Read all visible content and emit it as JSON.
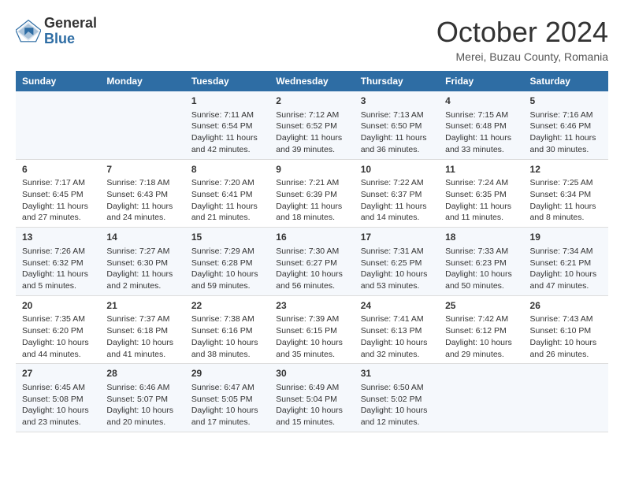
{
  "header": {
    "logo_general": "General",
    "logo_blue": "Blue",
    "month_title": "October 2024",
    "location": "Merei, Buzau County, Romania"
  },
  "weekdays": [
    "Sunday",
    "Monday",
    "Tuesday",
    "Wednesday",
    "Thursday",
    "Friday",
    "Saturday"
  ],
  "weeks": [
    [
      {
        "day": "",
        "sunrise": "",
        "sunset": "",
        "daylight": ""
      },
      {
        "day": "",
        "sunrise": "",
        "sunset": "",
        "daylight": ""
      },
      {
        "day": "1",
        "sunrise": "Sunrise: 7:11 AM",
        "sunset": "Sunset: 6:54 PM",
        "daylight": "Daylight: 11 hours and 42 minutes."
      },
      {
        "day": "2",
        "sunrise": "Sunrise: 7:12 AM",
        "sunset": "Sunset: 6:52 PM",
        "daylight": "Daylight: 11 hours and 39 minutes."
      },
      {
        "day": "3",
        "sunrise": "Sunrise: 7:13 AM",
        "sunset": "Sunset: 6:50 PM",
        "daylight": "Daylight: 11 hours and 36 minutes."
      },
      {
        "day": "4",
        "sunrise": "Sunrise: 7:15 AM",
        "sunset": "Sunset: 6:48 PM",
        "daylight": "Daylight: 11 hours and 33 minutes."
      },
      {
        "day": "5",
        "sunrise": "Sunrise: 7:16 AM",
        "sunset": "Sunset: 6:46 PM",
        "daylight": "Daylight: 11 hours and 30 minutes."
      }
    ],
    [
      {
        "day": "6",
        "sunrise": "Sunrise: 7:17 AM",
        "sunset": "Sunset: 6:45 PM",
        "daylight": "Daylight: 11 hours and 27 minutes."
      },
      {
        "day": "7",
        "sunrise": "Sunrise: 7:18 AM",
        "sunset": "Sunset: 6:43 PM",
        "daylight": "Daylight: 11 hours and 24 minutes."
      },
      {
        "day": "8",
        "sunrise": "Sunrise: 7:20 AM",
        "sunset": "Sunset: 6:41 PM",
        "daylight": "Daylight: 11 hours and 21 minutes."
      },
      {
        "day": "9",
        "sunrise": "Sunrise: 7:21 AM",
        "sunset": "Sunset: 6:39 PM",
        "daylight": "Daylight: 11 hours and 18 minutes."
      },
      {
        "day": "10",
        "sunrise": "Sunrise: 7:22 AM",
        "sunset": "Sunset: 6:37 PM",
        "daylight": "Daylight: 11 hours and 14 minutes."
      },
      {
        "day": "11",
        "sunrise": "Sunrise: 7:24 AM",
        "sunset": "Sunset: 6:35 PM",
        "daylight": "Daylight: 11 hours and 11 minutes."
      },
      {
        "day": "12",
        "sunrise": "Sunrise: 7:25 AM",
        "sunset": "Sunset: 6:34 PM",
        "daylight": "Daylight: 11 hours and 8 minutes."
      }
    ],
    [
      {
        "day": "13",
        "sunrise": "Sunrise: 7:26 AM",
        "sunset": "Sunset: 6:32 PM",
        "daylight": "Daylight: 11 hours and 5 minutes."
      },
      {
        "day": "14",
        "sunrise": "Sunrise: 7:27 AM",
        "sunset": "Sunset: 6:30 PM",
        "daylight": "Daylight: 11 hours and 2 minutes."
      },
      {
        "day": "15",
        "sunrise": "Sunrise: 7:29 AM",
        "sunset": "Sunset: 6:28 PM",
        "daylight": "Daylight: 10 hours and 59 minutes."
      },
      {
        "day": "16",
        "sunrise": "Sunrise: 7:30 AM",
        "sunset": "Sunset: 6:27 PM",
        "daylight": "Daylight: 10 hours and 56 minutes."
      },
      {
        "day": "17",
        "sunrise": "Sunrise: 7:31 AM",
        "sunset": "Sunset: 6:25 PM",
        "daylight": "Daylight: 10 hours and 53 minutes."
      },
      {
        "day": "18",
        "sunrise": "Sunrise: 7:33 AM",
        "sunset": "Sunset: 6:23 PM",
        "daylight": "Daylight: 10 hours and 50 minutes."
      },
      {
        "day": "19",
        "sunrise": "Sunrise: 7:34 AM",
        "sunset": "Sunset: 6:21 PM",
        "daylight": "Daylight: 10 hours and 47 minutes."
      }
    ],
    [
      {
        "day": "20",
        "sunrise": "Sunrise: 7:35 AM",
        "sunset": "Sunset: 6:20 PM",
        "daylight": "Daylight: 10 hours and 44 minutes."
      },
      {
        "day": "21",
        "sunrise": "Sunrise: 7:37 AM",
        "sunset": "Sunset: 6:18 PM",
        "daylight": "Daylight: 10 hours and 41 minutes."
      },
      {
        "day": "22",
        "sunrise": "Sunrise: 7:38 AM",
        "sunset": "Sunset: 6:16 PM",
        "daylight": "Daylight: 10 hours and 38 minutes."
      },
      {
        "day": "23",
        "sunrise": "Sunrise: 7:39 AM",
        "sunset": "Sunset: 6:15 PM",
        "daylight": "Daylight: 10 hours and 35 minutes."
      },
      {
        "day": "24",
        "sunrise": "Sunrise: 7:41 AM",
        "sunset": "Sunset: 6:13 PM",
        "daylight": "Daylight: 10 hours and 32 minutes."
      },
      {
        "day": "25",
        "sunrise": "Sunrise: 7:42 AM",
        "sunset": "Sunset: 6:12 PM",
        "daylight": "Daylight: 10 hours and 29 minutes."
      },
      {
        "day": "26",
        "sunrise": "Sunrise: 7:43 AM",
        "sunset": "Sunset: 6:10 PM",
        "daylight": "Daylight: 10 hours and 26 minutes."
      }
    ],
    [
      {
        "day": "27",
        "sunrise": "Sunrise: 6:45 AM",
        "sunset": "Sunset: 5:08 PM",
        "daylight": "Daylight: 10 hours and 23 minutes."
      },
      {
        "day": "28",
        "sunrise": "Sunrise: 6:46 AM",
        "sunset": "Sunset: 5:07 PM",
        "daylight": "Daylight: 10 hours and 20 minutes."
      },
      {
        "day": "29",
        "sunrise": "Sunrise: 6:47 AM",
        "sunset": "Sunset: 5:05 PM",
        "daylight": "Daylight: 10 hours and 17 minutes."
      },
      {
        "day": "30",
        "sunrise": "Sunrise: 6:49 AM",
        "sunset": "Sunset: 5:04 PM",
        "daylight": "Daylight: 10 hours and 15 minutes."
      },
      {
        "day": "31",
        "sunrise": "Sunrise: 6:50 AM",
        "sunset": "Sunset: 5:02 PM",
        "daylight": "Daylight: 10 hours and 12 minutes."
      },
      {
        "day": "",
        "sunrise": "",
        "sunset": "",
        "daylight": ""
      },
      {
        "day": "",
        "sunrise": "",
        "sunset": "",
        "daylight": ""
      }
    ]
  ]
}
